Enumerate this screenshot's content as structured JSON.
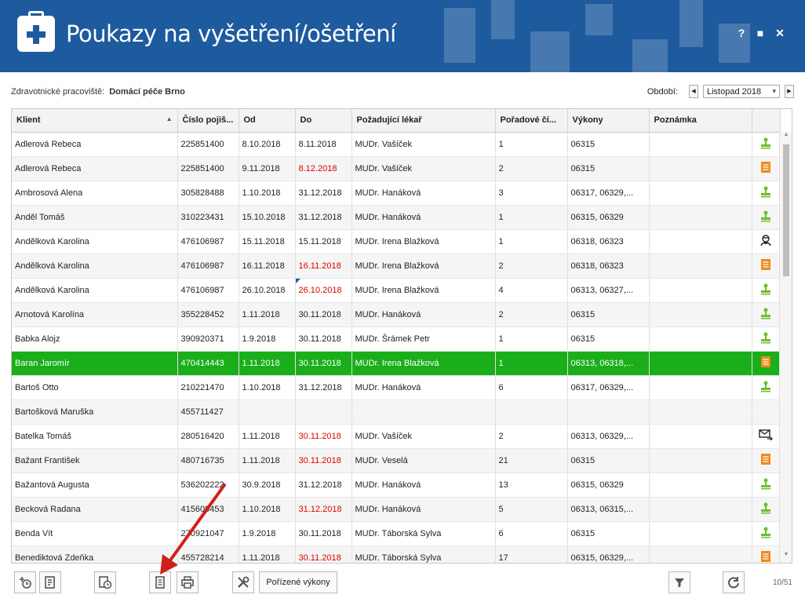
{
  "window": {
    "title": "Poukazy na vyšetření/ošetření",
    "help": "?",
    "maximize": "■",
    "close": "✕"
  },
  "workplace": {
    "label": "Zdravotnické pracoviště:",
    "value": "Domácí péče Brno"
  },
  "period": {
    "label": "Období:",
    "value": "Listopad 2018",
    "prev": "◀",
    "next": "▶",
    "dropdown": "▾"
  },
  "columns": [
    "Klient",
    "Číslo pojiš...",
    "Od",
    "Do",
    "Požadující lékař",
    "Pořadové čí...",
    "Výkony",
    "Poznámka",
    ""
  ],
  "sort_glyph": "▲",
  "rows": [
    {
      "klient": "Adlerová Rebeca",
      "cislo": "225851400",
      "od": "8.10.2018",
      "do": "8.11.2018",
      "do_red": false,
      "lekar": "MUDr. Vašíček",
      "poradove": "1",
      "vykony": "06315",
      "poznamka": "",
      "icon": "stamp"
    },
    {
      "klient": "Adlerová Rebeca",
      "cislo": "225851400",
      "od": "9.11.2018",
      "do": "8.12.2018",
      "do_red": true,
      "lekar": "MUDr. Vašíček",
      "poradove": "2",
      "vykony": "06315",
      "poznamka": "",
      "icon": "doc"
    },
    {
      "klient": "Ambrosová Alena",
      "cislo": "305828488",
      "od": "1.10.2018",
      "do": "31.12.2018",
      "do_red": false,
      "lekar": "MUDr. Hanáková",
      "poradove": "3",
      "vykony": "06317, 06329,...",
      "poznamka": "",
      "icon": "stamp"
    },
    {
      "klient": "Anděl Tomáš",
      "cislo": "310223431",
      "od": "15.10.2018",
      "do": "31.12.2018",
      "do_red": false,
      "lekar": "MUDr. Hanáková",
      "poradove": "1",
      "vykony": "06315, 06329",
      "poznamka": "",
      "icon": "stamp"
    },
    {
      "klient": "Andělková Karolina",
      "cislo": "476106987",
      "od": "15.11.2018",
      "do": "15.11.2018",
      "do_red": false,
      "lekar": "MUDr. Irena Blažková",
      "poradove": "1",
      "vykony": "06318, 06323",
      "poznamka": "",
      "icon": "doctor"
    },
    {
      "klient": "Andělková Karolina",
      "cislo": "476106987",
      "od": "16.11.2018",
      "do": "16.11.2018",
      "do_red": true,
      "lekar": "MUDr. Irena Blažková",
      "poradove": "2",
      "vykony": "06318, 06323",
      "poznamka": "",
      "icon": "doc"
    },
    {
      "klient": "Andělková Karolina",
      "cislo": "476106987",
      "od": "26.10.2018",
      "do": "26.10.2018",
      "do_red": true,
      "marker": true,
      "lekar": "MUDr. Irena Blažková",
      "poradove": "4",
      "vykony": "06313, 06327,...",
      "poznamka": "",
      "icon": "stamp"
    },
    {
      "klient": "Arnotová Karolína",
      "cislo": "355228452",
      "od": "1.11.2018",
      "do": "30.11.2018",
      "do_red": false,
      "lekar": "MUDr. Hanáková",
      "poradove": "2",
      "vykony": "06315",
      "poznamka": "",
      "icon": "stamp"
    },
    {
      "klient": "Babka Alojz",
      "cislo": "390920371",
      "od": "1.9.2018",
      "do": "30.11.2018",
      "do_red": false,
      "lekar": "MUDr. Šrámek Petr",
      "poradove": "1",
      "vykony": "06315",
      "poznamka": "",
      "icon": "stamp"
    },
    {
      "klient": "Baran Jaromír",
      "cislo": "470414443",
      "od": "1.11.2018",
      "do": "30.11.2018",
      "do_red": false,
      "lekar": "MUDr. Irena Blažková",
      "poradove": "1",
      "vykony": "06313, 06318,...",
      "poznamka": "",
      "icon": "doc",
      "selected": true
    },
    {
      "klient": "Bartoš Otto",
      "cislo": "210221470",
      "od": "1.10.2018",
      "do": "31.12.2018",
      "do_red": false,
      "lekar": "MUDr. Hanáková",
      "poradove": "6",
      "vykony": "06317, 06329,...",
      "poznamka": "",
      "icon": "stamp"
    },
    {
      "klient": "Bartošková Maruška",
      "cislo": "455711427",
      "od": "",
      "do": "",
      "do_red": false,
      "lekar": "",
      "poradove": "",
      "vykony": "",
      "poznamka": "",
      "icon": ""
    },
    {
      "klient": "Batelka Tomáš",
      "cislo": "280516420",
      "od": "1.11.2018",
      "do": "30.11.2018",
      "do_red": true,
      "lekar": "MUDr. Vašíček",
      "poradove": "2",
      "vykony": "06313, 06329,...",
      "poznamka": "",
      "icon": "mail"
    },
    {
      "klient": "Bažant František",
      "cislo": "480716735",
      "od": "1.11.2018",
      "do": "30.11.2018",
      "do_red": true,
      "lekar": "MUDr. Veselá",
      "poradove": "21",
      "vykony": "06315",
      "poznamka": "",
      "icon": "doc"
    },
    {
      "klient": "Bažantová Augusta",
      "cislo": "536202222",
      "od": "30.9.2018",
      "do": "31.12.2018",
      "do_red": false,
      "lekar": "MUDr. Hanáková",
      "poradove": "13",
      "vykony": "06315, 06329",
      "poznamka": "",
      "icon": "stamp"
    },
    {
      "klient": "Becková Radana",
      "cislo": "415609453",
      "od": "1.10.2018",
      "do": "31.12.2018",
      "do_red": true,
      "lekar": "MUDr. Hanáková",
      "poradove": "5",
      "vykony": "06313, 06315,...",
      "poznamka": "",
      "icon": "stamp"
    },
    {
      "klient": "Benda Vít",
      "cislo": "270921047",
      "od": "1.9.2018",
      "do": "30.11.2018",
      "do_red": false,
      "lekar": "MUDr. Táborská Sylva",
      "poradove": "6",
      "vykony": "06315",
      "poznamka": "",
      "icon": "stamp"
    },
    {
      "klient": "Benediktová Zdeňka",
      "cislo": "455728214",
      "od": "1.11.2018",
      "do": "30.11.2018",
      "do_red": true,
      "lekar": "MUDr. Táborská Sylva",
      "poradove": "17",
      "vykony": "06315, 06329,...",
      "poznamka": "",
      "icon": "doc"
    }
  ],
  "toolbar": {
    "porizene_vykony": "Pořízené výkony",
    "counter": "10/51"
  },
  "colors": {
    "titlebar": "#1e5a9e",
    "selected_row": "#1aaf1a",
    "overdue": "#e00000",
    "stamp_icon": "#6cbf2a",
    "doc_icon": "#f08a1c",
    "annotation_arrow": "#d0201c"
  }
}
